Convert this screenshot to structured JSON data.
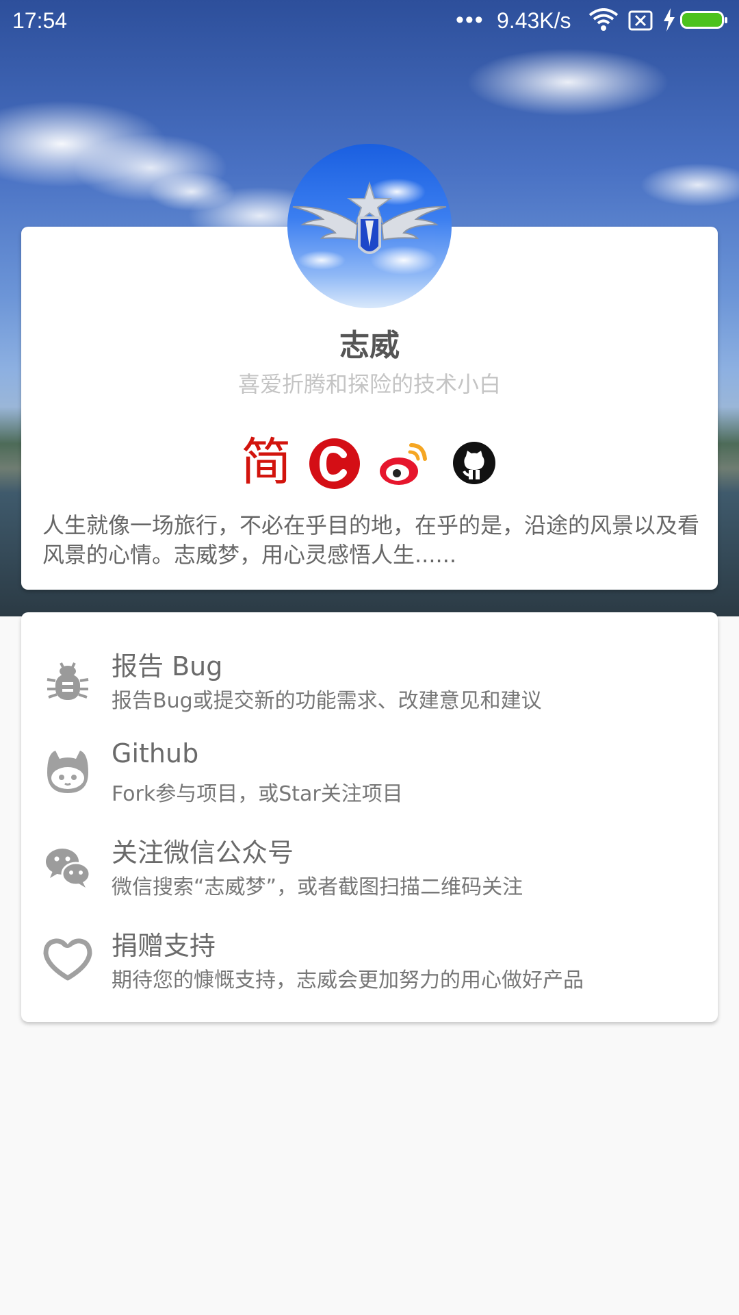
{
  "status_bar": {
    "time": "17:54",
    "more": "•••",
    "network_speed": "9.43K/s",
    "battery_color": "#4cc21d"
  },
  "profile": {
    "name": "志威",
    "motto": "喜爱折腾和探险的技术小白",
    "social": [
      {
        "label": "简",
        "icon": "jianshu-icon",
        "color": "#d2140d"
      },
      {
        "label": "C",
        "icon": "csdn-icon",
        "color": "#d40e15"
      },
      {
        "icon": "weibo-icon",
        "color": "#e6162d"
      },
      {
        "icon": "github-icon",
        "color": "#111111"
      }
    ],
    "description": "人生就像一场旅行，不必在乎目的地，在乎的是，沿途的风景以及看风景的心情。志威梦，用心灵感悟人生......"
  },
  "menu": [
    {
      "title": "报告 Bug",
      "subtitle": "报告Bug或提交新的功能需求、改建意见和建议",
      "icon": "bug-icon"
    },
    {
      "title": "Github",
      "subtitle": "Fork参与项目，或Star关注项目",
      "icon": "github-cat-icon"
    },
    {
      "title": "关注微信公众号",
      "subtitle": "微信搜索“志威梦”，或者截图扫描二维码关注",
      "icon": "wechat-icon"
    },
    {
      "title": "捐赠支持",
      "subtitle": "期待您的慷慨支持，志威会更加努力的用心做好产品",
      "icon": "heart-icon"
    }
  ]
}
